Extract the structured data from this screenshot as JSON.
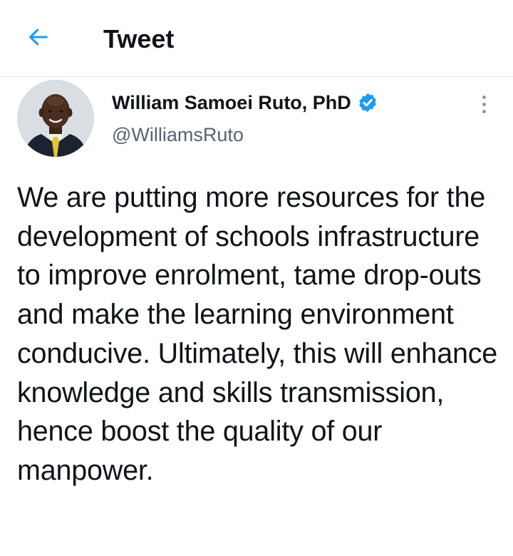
{
  "header": {
    "title": "Tweet",
    "back_icon": "arrow-left-icon",
    "accent_color": "#1d9bf0"
  },
  "author": {
    "display_name": "William Samoei Ruto, PhD",
    "handle": "@WilliamsRuto",
    "verified": true,
    "verified_color": "#1d9bf0"
  },
  "tweet": {
    "text": "We are putting more resources for the development of schools infrastructure to improve enrolment, tame drop-outs and make the learning environment conducive. Ultimately, this will enhance knowledge and skills transmission, hence boost the quality of our manpower."
  },
  "menu": {
    "icon": "more-vertical-icon"
  }
}
